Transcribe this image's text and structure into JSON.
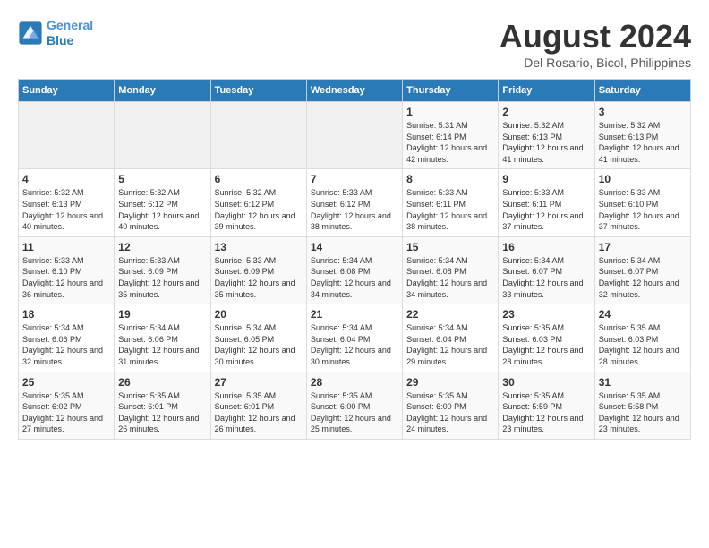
{
  "logo": {
    "line1": "General",
    "line2": "Blue"
  },
  "calendar": {
    "title": "August 2024",
    "subtitle": "Del Rosario, Bicol, Philippines"
  },
  "weekdays": [
    "Sunday",
    "Monday",
    "Tuesday",
    "Wednesday",
    "Thursday",
    "Friday",
    "Saturday"
  ],
  "weeks": [
    [
      {
        "day": "",
        "sunrise": "",
        "sunset": "",
        "daylight": ""
      },
      {
        "day": "",
        "sunrise": "",
        "sunset": "",
        "daylight": ""
      },
      {
        "day": "",
        "sunrise": "",
        "sunset": "",
        "daylight": ""
      },
      {
        "day": "",
        "sunrise": "",
        "sunset": "",
        "daylight": ""
      },
      {
        "day": "1",
        "sunrise": "Sunrise: 5:31 AM",
        "sunset": "Sunset: 6:14 PM",
        "daylight": "Daylight: 12 hours and 42 minutes."
      },
      {
        "day": "2",
        "sunrise": "Sunrise: 5:32 AM",
        "sunset": "Sunset: 6:13 PM",
        "daylight": "Daylight: 12 hours and 41 minutes."
      },
      {
        "day": "3",
        "sunrise": "Sunrise: 5:32 AM",
        "sunset": "Sunset: 6:13 PM",
        "daylight": "Daylight: 12 hours and 41 minutes."
      }
    ],
    [
      {
        "day": "4",
        "sunrise": "Sunrise: 5:32 AM",
        "sunset": "Sunset: 6:13 PM",
        "daylight": "Daylight: 12 hours and 40 minutes."
      },
      {
        "day": "5",
        "sunrise": "Sunrise: 5:32 AM",
        "sunset": "Sunset: 6:12 PM",
        "daylight": "Daylight: 12 hours and 40 minutes."
      },
      {
        "day": "6",
        "sunrise": "Sunrise: 5:32 AM",
        "sunset": "Sunset: 6:12 PM",
        "daylight": "Daylight: 12 hours and 39 minutes."
      },
      {
        "day": "7",
        "sunrise": "Sunrise: 5:33 AM",
        "sunset": "Sunset: 6:12 PM",
        "daylight": "Daylight: 12 hours and 38 minutes."
      },
      {
        "day": "8",
        "sunrise": "Sunrise: 5:33 AM",
        "sunset": "Sunset: 6:11 PM",
        "daylight": "Daylight: 12 hours and 38 minutes."
      },
      {
        "day": "9",
        "sunrise": "Sunrise: 5:33 AM",
        "sunset": "Sunset: 6:11 PM",
        "daylight": "Daylight: 12 hours and 37 minutes."
      },
      {
        "day": "10",
        "sunrise": "Sunrise: 5:33 AM",
        "sunset": "Sunset: 6:10 PM",
        "daylight": "Daylight: 12 hours and 37 minutes."
      }
    ],
    [
      {
        "day": "11",
        "sunrise": "Sunrise: 5:33 AM",
        "sunset": "Sunset: 6:10 PM",
        "daylight": "Daylight: 12 hours and 36 minutes."
      },
      {
        "day": "12",
        "sunrise": "Sunrise: 5:33 AM",
        "sunset": "Sunset: 6:09 PM",
        "daylight": "Daylight: 12 hours and 35 minutes."
      },
      {
        "day": "13",
        "sunrise": "Sunrise: 5:33 AM",
        "sunset": "Sunset: 6:09 PM",
        "daylight": "Daylight: 12 hours and 35 minutes."
      },
      {
        "day": "14",
        "sunrise": "Sunrise: 5:34 AM",
        "sunset": "Sunset: 6:08 PM",
        "daylight": "Daylight: 12 hours and 34 minutes."
      },
      {
        "day": "15",
        "sunrise": "Sunrise: 5:34 AM",
        "sunset": "Sunset: 6:08 PM",
        "daylight": "Daylight: 12 hours and 34 minutes."
      },
      {
        "day": "16",
        "sunrise": "Sunrise: 5:34 AM",
        "sunset": "Sunset: 6:07 PM",
        "daylight": "Daylight: 12 hours and 33 minutes."
      },
      {
        "day": "17",
        "sunrise": "Sunrise: 5:34 AM",
        "sunset": "Sunset: 6:07 PM",
        "daylight": "Daylight: 12 hours and 32 minutes."
      }
    ],
    [
      {
        "day": "18",
        "sunrise": "Sunrise: 5:34 AM",
        "sunset": "Sunset: 6:06 PM",
        "daylight": "Daylight: 12 hours and 32 minutes."
      },
      {
        "day": "19",
        "sunrise": "Sunrise: 5:34 AM",
        "sunset": "Sunset: 6:06 PM",
        "daylight": "Daylight: 12 hours and 31 minutes."
      },
      {
        "day": "20",
        "sunrise": "Sunrise: 5:34 AM",
        "sunset": "Sunset: 6:05 PM",
        "daylight": "Daylight: 12 hours and 30 minutes."
      },
      {
        "day": "21",
        "sunrise": "Sunrise: 5:34 AM",
        "sunset": "Sunset: 6:04 PM",
        "daylight": "Daylight: 12 hours and 30 minutes."
      },
      {
        "day": "22",
        "sunrise": "Sunrise: 5:34 AM",
        "sunset": "Sunset: 6:04 PM",
        "daylight": "Daylight: 12 hours and 29 minutes."
      },
      {
        "day": "23",
        "sunrise": "Sunrise: 5:35 AM",
        "sunset": "Sunset: 6:03 PM",
        "daylight": "Daylight: 12 hours and 28 minutes."
      },
      {
        "day": "24",
        "sunrise": "Sunrise: 5:35 AM",
        "sunset": "Sunset: 6:03 PM",
        "daylight": "Daylight: 12 hours and 28 minutes."
      }
    ],
    [
      {
        "day": "25",
        "sunrise": "Sunrise: 5:35 AM",
        "sunset": "Sunset: 6:02 PM",
        "daylight": "Daylight: 12 hours and 27 minutes."
      },
      {
        "day": "26",
        "sunrise": "Sunrise: 5:35 AM",
        "sunset": "Sunset: 6:01 PM",
        "daylight": "Daylight: 12 hours and 26 minutes."
      },
      {
        "day": "27",
        "sunrise": "Sunrise: 5:35 AM",
        "sunset": "Sunset: 6:01 PM",
        "daylight": "Daylight: 12 hours and 26 minutes."
      },
      {
        "day": "28",
        "sunrise": "Sunrise: 5:35 AM",
        "sunset": "Sunset: 6:00 PM",
        "daylight": "Daylight: 12 hours and 25 minutes."
      },
      {
        "day": "29",
        "sunrise": "Sunrise: 5:35 AM",
        "sunset": "Sunset: 6:00 PM",
        "daylight": "Daylight: 12 hours and 24 minutes."
      },
      {
        "day": "30",
        "sunrise": "Sunrise: 5:35 AM",
        "sunset": "Sunset: 5:59 PM",
        "daylight": "Daylight: 12 hours and 23 minutes."
      },
      {
        "day": "31",
        "sunrise": "Sunrise: 5:35 AM",
        "sunset": "Sunset: 5:58 PM",
        "daylight": "Daylight: 12 hours and 23 minutes."
      }
    ]
  ]
}
